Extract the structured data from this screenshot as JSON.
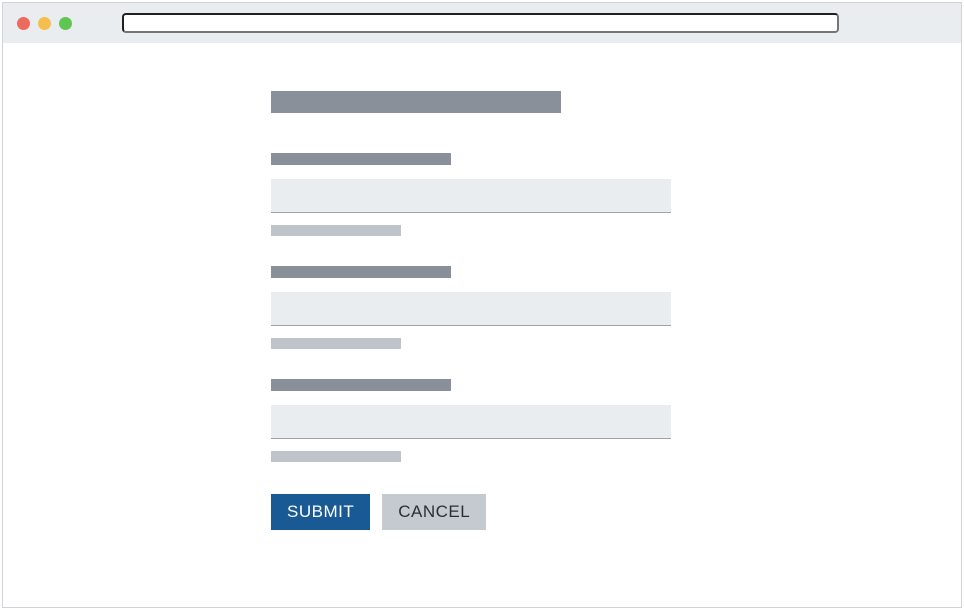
{
  "window": {
    "address": ""
  },
  "form": {
    "title": "",
    "fields": [
      {
        "label": "",
        "value": "",
        "hint": ""
      },
      {
        "label": "",
        "value": "",
        "hint": ""
      },
      {
        "label": "",
        "value": "",
        "hint": ""
      }
    ],
    "buttons": {
      "submit": "SUBMIT",
      "cancel": "CANCEL"
    }
  }
}
